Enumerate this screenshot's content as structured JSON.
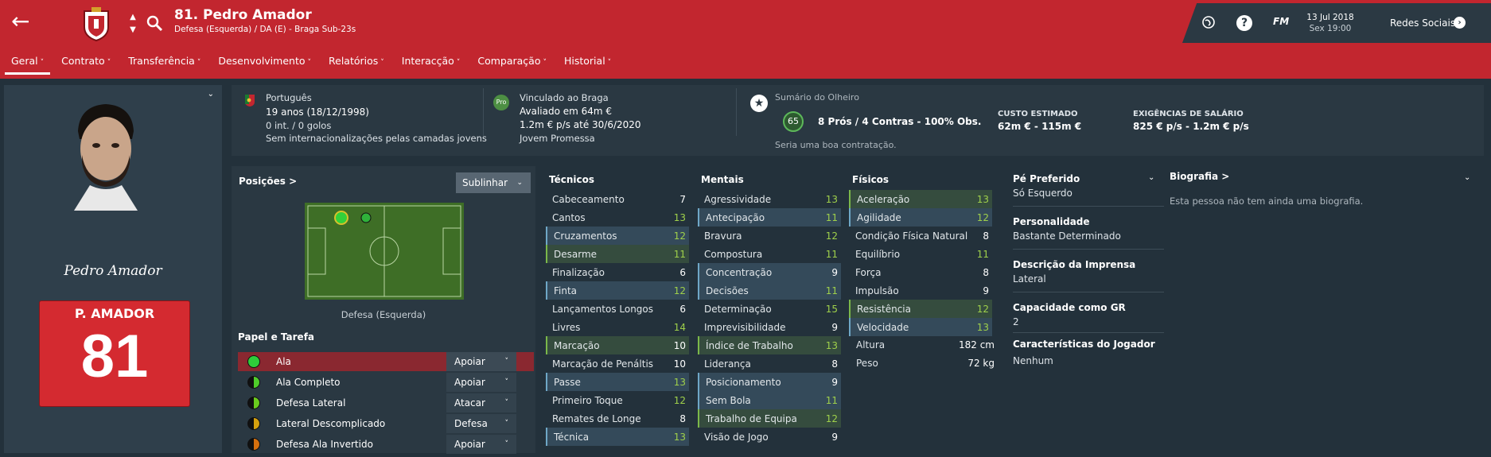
{
  "header": {
    "player_title": "81. Pedro Amador",
    "player_subtitle": "Defesa (Esquerda) / DA (E) - Braga Sub-23s",
    "date": "13 Jul 2018",
    "time": "Sex 19:00",
    "fm_label": "FM",
    "social": "Redes Sociais",
    "brand_color": "#c2262f"
  },
  "tabs": [
    "Geral",
    "Contrato",
    "Transferência",
    "Desenvolvimento",
    "Relatórios",
    "Interacção",
    "Comparação",
    "Historial"
  ],
  "profile": {
    "signature": "Pedro Amador",
    "shirt_name": "P. AMADOR",
    "shirt_number": "81"
  },
  "info": {
    "nationality": "Português",
    "age": "19 anos (18/12/1998)",
    "intl": "0 int. / 0 golos",
    "youth": "Sem internacionalizações pelas camadas jovens",
    "club_link": "Vinculado ao Braga",
    "value": "Avaliado em 64m €",
    "wage": "1.2m € p/s até 30/6/2020",
    "status": "Jovem Promessa",
    "scout_title": "Sumário do Olheiro",
    "scout_rating": "65",
    "scout_summary": "8 Prós / 4 Contras - 100% Obs.",
    "scout_note": "Seria uma boa contratação.",
    "cost_label": "CUSTO ESTIMADO",
    "cost_value": "62m € - 115m €",
    "salary_label": "EXIGÊNCIAS DE SALÁRIO",
    "salary_value": "825 € p/s - 1.2m € p/s"
  },
  "positions": {
    "title": "Posições >",
    "dropdown": "Sublinhar",
    "caption": "Defesa (Esquerda)"
  },
  "roles": {
    "title": "Papel e Tarefa",
    "items": [
      {
        "name": "Ala",
        "duty": "Apoiar",
        "color": "#2ecc3a"
      },
      {
        "name": "Ala Completo",
        "duty": "Apoiar",
        "color": "#4fcc2a"
      },
      {
        "name": "Defesa Lateral",
        "duty": "Atacar",
        "color": "#6acc1e"
      },
      {
        "name": "Lateral Descomplicado",
        "duty": "Defesa",
        "color": "#d6a10e"
      },
      {
        "name": "Defesa Ala Invertido",
        "duty": "Apoiar",
        "color": "#d6700e"
      }
    ]
  },
  "technical": {
    "title": "Técnicos",
    "rows": [
      {
        "name": "Cabeceamento",
        "value": "7",
        "hl": ""
      },
      {
        "name": "Cantos",
        "value": "13",
        "hl": ""
      },
      {
        "name": "Cruzamentos",
        "value": "12",
        "hl": "s"
      },
      {
        "name": "Desarme",
        "value": "11",
        "hl": "g"
      },
      {
        "name": "Finalização",
        "value": "6",
        "hl": ""
      },
      {
        "name": "Finta",
        "value": "12",
        "hl": "s"
      },
      {
        "name": "Lançamentos Longos",
        "value": "6",
        "hl": ""
      },
      {
        "name": "Livres",
        "value": "14",
        "hl": ""
      },
      {
        "name": "Marcação",
        "value": "10",
        "hl": "g"
      },
      {
        "name": "Marcação de Penáltis",
        "value": "10",
        "hl": ""
      },
      {
        "name": "Passe",
        "value": "13",
        "hl": "s"
      },
      {
        "name": "Primeiro Toque",
        "value": "12",
        "hl": ""
      },
      {
        "name": "Remates de Longe",
        "value": "8",
        "hl": ""
      },
      {
        "name": "Técnica",
        "value": "13",
        "hl": "s"
      }
    ]
  },
  "mental": {
    "title": "Mentais",
    "rows": [
      {
        "name": "Agressividade",
        "value": "13",
        "hl": ""
      },
      {
        "name": "Antecipação",
        "value": "11",
        "hl": "s"
      },
      {
        "name": "Bravura",
        "value": "12",
        "hl": ""
      },
      {
        "name": "Compostura",
        "value": "11",
        "hl": ""
      },
      {
        "name": "Concentração",
        "value": "9",
        "hl": "s"
      },
      {
        "name": "Decisões",
        "value": "11",
        "hl": "s"
      },
      {
        "name": "Determinação",
        "value": "15",
        "hl": ""
      },
      {
        "name": "Imprevisibilidade",
        "value": "9",
        "hl": ""
      },
      {
        "name": "Índice de Trabalho",
        "value": "13",
        "hl": "g"
      },
      {
        "name": "Liderança",
        "value": "8",
        "hl": ""
      },
      {
        "name": "Posicionamento",
        "value": "9",
        "hl": "s"
      },
      {
        "name": "Sem Bola",
        "value": "11",
        "hl": "s"
      },
      {
        "name": "Trabalho de Equipa",
        "value": "12",
        "hl": "g"
      },
      {
        "name": "Visão de Jogo",
        "value": "9",
        "hl": ""
      }
    ]
  },
  "physical": {
    "title": "Físicos",
    "rows": [
      {
        "name": "Aceleração",
        "value": "13",
        "hl": "g"
      },
      {
        "name": "Agilidade",
        "value": "12",
        "hl": "s"
      },
      {
        "name": "Condição Física Natural",
        "value": "8",
        "hl": ""
      },
      {
        "name": "Equilíbrio",
        "value": "11",
        "hl": ""
      },
      {
        "name": "Força",
        "value": "8",
        "hl": ""
      },
      {
        "name": "Impulsão",
        "value": "9",
        "hl": ""
      },
      {
        "name": "Resistência",
        "value": "12",
        "hl": "g"
      },
      {
        "name": "Velocidade",
        "value": "13",
        "hl": "s"
      }
    ],
    "height_label": "Altura",
    "height": "182 cm",
    "weight_label": "Peso",
    "weight": "72 kg"
  },
  "details": {
    "foot_label": "Pé Preferido",
    "foot": "Só Esquerdo",
    "pers_label": "Personalidade",
    "pers": "Bastante Determinado",
    "press_label": "Descrição da Imprensa",
    "press": "Lateral",
    "gk_label": "Capacidade como GR",
    "gk": "2",
    "traits_label": "Características do Jogador",
    "traits": "Nenhum"
  },
  "bio": {
    "title": "Biografia >",
    "text": "Esta pessoa não tem ainda uma biografia."
  }
}
